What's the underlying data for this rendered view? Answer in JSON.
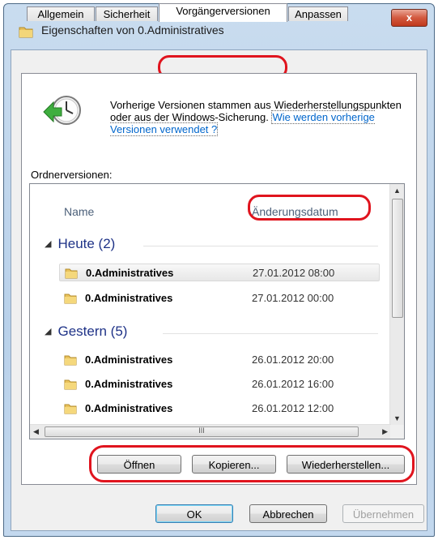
{
  "window": {
    "title": "Eigenschaften von 0.Administratives",
    "close_label": "x"
  },
  "tabs": [
    {
      "label": "Allgemein"
    },
    {
      "label": "Sicherheit"
    },
    {
      "label": "Vorgängerversionen"
    },
    {
      "label": "Anpassen"
    }
  ],
  "description": {
    "text": "Vorherige Versionen stammen aus Wiederherstellungspunkten oder aus der Windows-Sicherung.",
    "link": "Wie werden vorherige Versionen verwendet ?"
  },
  "folder_versions_label": "Ordnerversionen:",
  "columns": {
    "name": "Name",
    "date": "Änderungsdatum"
  },
  "groups": [
    {
      "title": "Heute (2)",
      "items": [
        {
          "name": "0.Administratives",
          "date": "27.01.2012 08:00"
        },
        {
          "name": "0.Administratives",
          "date": "27.01.2012 00:00"
        }
      ]
    },
    {
      "title": "Gestern (5)",
      "items": [
        {
          "name": "0.Administratives",
          "date": "26.01.2012 20:00"
        },
        {
          "name": "0.Administratives",
          "date": "26.01.2012 16:00"
        },
        {
          "name": "0.Administratives",
          "date": "26.01.2012 12:00"
        }
      ]
    }
  ],
  "scrollbar": {
    "grip": "III"
  },
  "actions": {
    "open": "Öffnen",
    "copy": "Kopieren...",
    "restore": "Wiederherstellen..."
  },
  "dialog": {
    "ok": "OK",
    "cancel": "Abbrechen",
    "apply": "Übernehmen"
  },
  "colors": {
    "highlight": "#e0141e",
    "link": "#0066cc",
    "group_header": "#1e3287"
  }
}
